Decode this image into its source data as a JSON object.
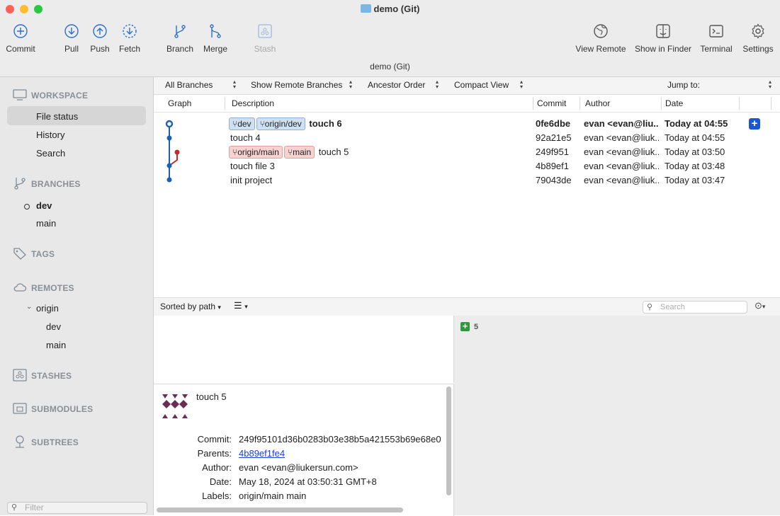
{
  "window": {
    "title": "demo (Git)",
    "subtitle": "demo (Git)"
  },
  "toolbar": {
    "commit": "Commit",
    "pull": "Pull",
    "push": "Push",
    "fetch": "Fetch",
    "branch": "Branch",
    "merge": "Merge",
    "stash": "Stash",
    "view_remote": "View Remote",
    "show_in_finder": "Show in Finder",
    "terminal": "Terminal",
    "settings": "Settings"
  },
  "sidebar": {
    "workspace": "WORKSPACE",
    "file_status": "File status",
    "history": "History",
    "search": "Search",
    "branches": "BRANCHES",
    "branch_dev": "dev",
    "branch_main": "main",
    "tags": "TAGS",
    "remotes": "REMOTES",
    "origin": "origin",
    "origin_dev": "dev",
    "origin_main": "main",
    "stashes": "STASHES",
    "submodules": "SUBMODULES",
    "subtrees": "SUBTREES",
    "filter_placeholder": "Filter"
  },
  "filters": {
    "branches": "All Branches",
    "remote": "Show Remote Branches",
    "order": "Ancestor Order",
    "view": "Compact View",
    "jump": "Jump to:"
  },
  "columns": {
    "graph": "Graph",
    "description": "Description",
    "commit": "Commit",
    "author": "Author",
    "date": "Date"
  },
  "commits": [
    {
      "tags": [
        "dev",
        "origin/dev"
      ],
      "message": "touch 6",
      "hash": "0fe6dbe",
      "author": "evan <evan@liu...",
      "date": "Today at 04:55"
    },
    {
      "tags": [],
      "message": "touch 4",
      "hash": "92a21e5",
      "author": "evan <evan@liuk...",
      "date": "Today at 04:55"
    },
    {
      "tags": [
        "origin/main",
        "main"
      ],
      "message": "touch 5",
      "hash": "249f951",
      "author": "evan <evan@liuk...",
      "date": "Today at 03:50"
    },
    {
      "tags": [],
      "message": "touch file 3",
      "hash": "4b89ef1",
      "author": "evan <evan@liuk...",
      "date": "Today at 03:48"
    },
    {
      "tags": [],
      "message": "init project",
      "hash": "79043de",
      "author": "evan <evan@liuk...",
      "date": "Today at 03:47"
    }
  ],
  "lower": {
    "sort": "Sorted by path",
    "search_placeholder": "Search",
    "count": "5"
  },
  "details": {
    "subject": "touch 5",
    "commit_label": "Commit:",
    "commit": "249f95101d36b0283b03e38b5a421553b69e68e0",
    "parents_label": "Parents:",
    "parents": "4b89ef1fe4",
    "author_label": "Author:",
    "author": "evan <evan@liukersun.com>",
    "date_label": "Date:",
    "date": "May 18, 2024 at 03:50:31 GMT+8",
    "labels_label": "Labels:",
    "labels": "origin/main main"
  },
  "colors": {
    "accent": "#1a57d6",
    "graph_blue": "#1c5fb3",
    "graph_red": "#c8282a"
  }
}
